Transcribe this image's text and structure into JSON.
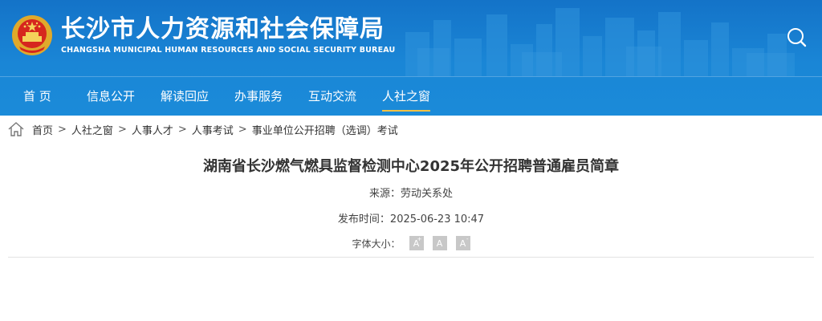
{
  "header": {
    "title_cn": "长沙市人力资源和社会保障局",
    "title_en": "CHANGSHA MUNICIPAL HUMAN RESOURCES AND SOCIAL SECURITY BUREAU",
    "search_icon": "search-icon",
    "emblem_icon": "national-emblem-icon"
  },
  "nav": {
    "items": [
      {
        "label": "首 页"
      },
      {
        "label": "信息公开"
      },
      {
        "label": "解读回应"
      },
      {
        "label": "办事服务"
      },
      {
        "label": "互动交流"
      },
      {
        "label": "人社之窗"
      }
    ],
    "active": "人社之窗",
    "accent": "#f6c244"
  },
  "breadcrumb": {
    "home_icon": "home-icon",
    "items": [
      "首页",
      "人社之窗",
      "人事人才",
      "人事考试",
      "事业单位公开招聘（选调）考试"
    ],
    "separator": ">"
  },
  "article": {
    "title": "湖南省长沙燃气燃具监督检测中心2025年公开招聘普通雇员简章",
    "source": "来源：劳动关系处",
    "publish_time": "发布时间：2025-06-23 10:47",
    "font_size_label": "字体大小：",
    "font_buttons": [
      "A",
      "A",
      "A"
    ]
  },
  "colors": {
    "header_bg": "#1a86d6",
    "text": "#333333"
  }
}
